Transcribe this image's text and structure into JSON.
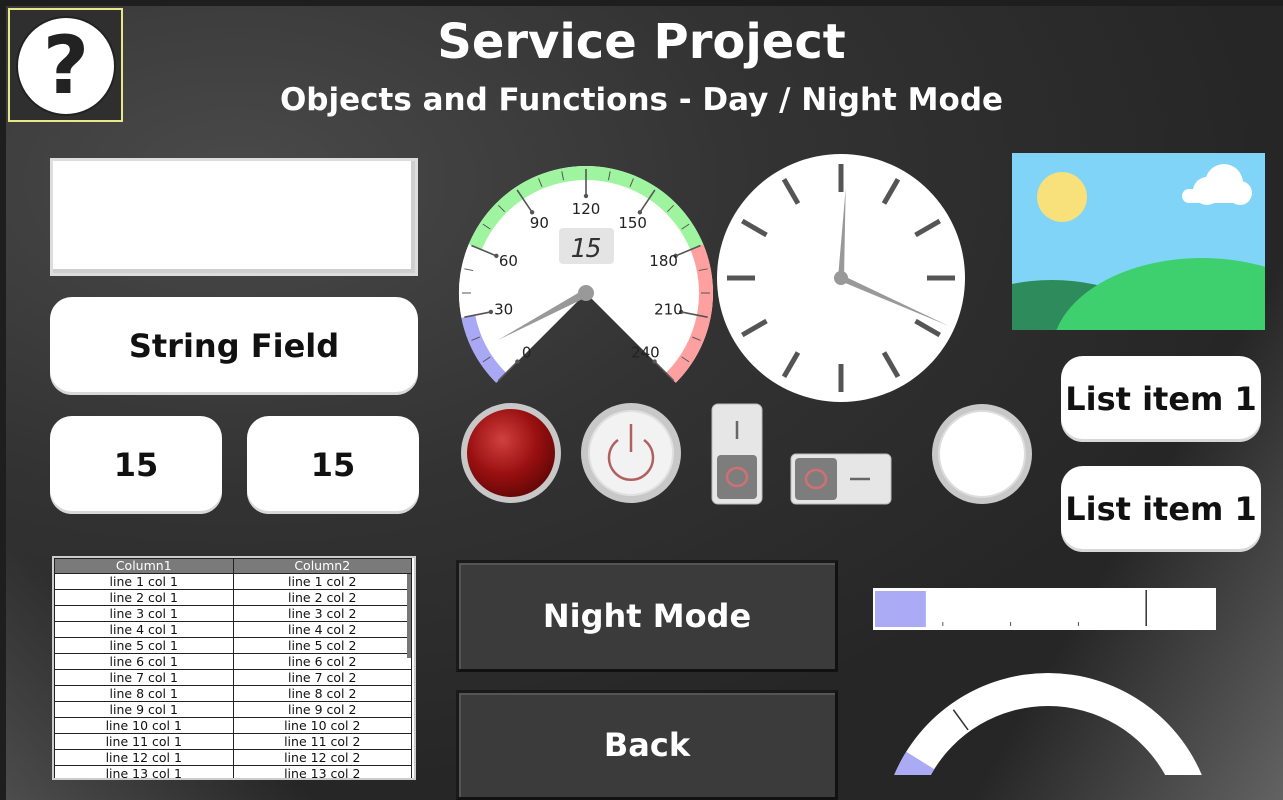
{
  "header": {
    "title": "Service Project",
    "subtitle": "Objects and Functions - Day / Night Mode"
  },
  "help_button": {
    "label": "?"
  },
  "fields": {
    "string_field": "String Field",
    "numeric_1": "15",
    "numeric_2": "15"
  },
  "speedometer": {
    "ticks": [
      "0",
      "30",
      "60",
      "90",
      "120",
      "150",
      "180",
      "210",
      "240"
    ],
    "digital_readout": "15",
    "value": 15,
    "min": 0,
    "max": 240,
    "bands": [
      {
        "from": 0,
        "to": 30,
        "color": "#a8a8f5"
      },
      {
        "from": 30,
        "to": 60,
        "color": "#ffffff"
      },
      {
        "from": 60,
        "to": 180,
        "color": "#9ff59f"
      },
      {
        "from": 180,
        "to": 240,
        "color": "#ffa0a0"
      }
    ]
  },
  "clock": {
    "hour_hand_minutes": 0.5,
    "minute_hand_minutes": 19
  },
  "list_items": [
    "List item 1",
    "List item 1"
  ],
  "table": {
    "columns": [
      "Column1",
      "Column2"
    ],
    "rows": [
      [
        "line 1 col 1",
        "line 1 col 2"
      ],
      [
        "line 2 col 1",
        "line 2 col 2"
      ],
      [
        "line 3 col 1",
        "line 3 col 2"
      ],
      [
        "line 4 col 1",
        "line 4 col 2"
      ],
      [
        "line 5 col 1",
        "line 5 col 2"
      ],
      [
        "line 6 col 1",
        "line 6 col 2"
      ],
      [
        "line 7 col 1",
        "line 7 col 2"
      ],
      [
        "line 8 col 1",
        "line 8 col 2"
      ],
      [
        "line 9 col 1",
        "line 9 col 2"
      ],
      [
        "line 10 col 1",
        "line 10 col 2"
      ],
      [
        "line 11 col 1",
        "line 11 col 2"
      ],
      [
        "line 12 col 1",
        "line 12 col 2"
      ],
      [
        "line 13 col 1",
        "line 13 col 2"
      ]
    ]
  },
  "buttons": {
    "night_mode": "Night Mode",
    "back": "Back"
  },
  "bar_gauge": {
    "value_fraction": 0.15,
    "marker_fraction": 0.8,
    "fill_color": "#aaaaf5"
  },
  "arc_gauge": {
    "value_fraction": 0.05,
    "marker_fraction": 0.3,
    "fill_color": "#aaaaf5"
  },
  "indicators": {
    "lamp": "red-lamp-icon",
    "power": "power-icon",
    "switch_vertical": "rocker-switch-icon",
    "switch_horizontal": "toggle-switch-icon",
    "round_button": "round-button-icon"
  },
  "colors": {
    "background": "#2e2e2e",
    "accent_day": "#ffffff",
    "lamp_red": "#9a1010"
  }
}
